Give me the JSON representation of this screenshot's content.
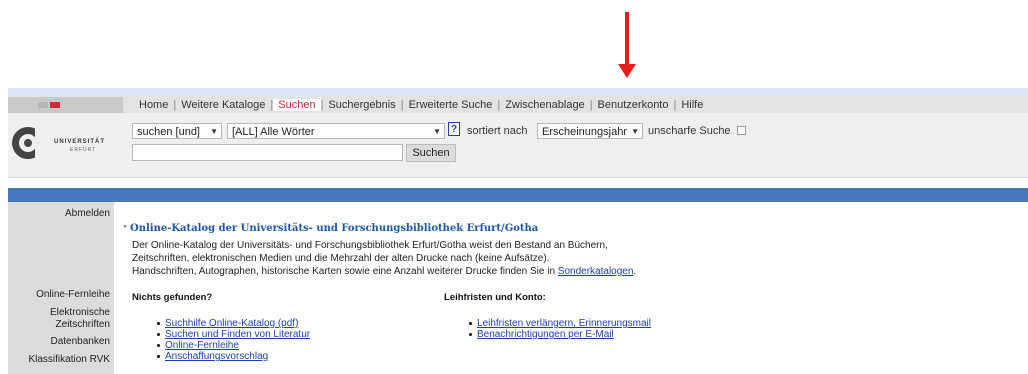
{
  "flags": {
    "de": "German flag",
    "uk": "UK flag"
  },
  "logo": {
    "line1": "UNIVERSITÄT",
    "line2": "ERFURT"
  },
  "menu": [
    "Home",
    "Weitere Kataloge",
    "Suchen",
    "Suchergebnis",
    "Erweiterte Suche",
    "Zwischenablage",
    "Benutzerkonto",
    "Hilfe"
  ],
  "search": {
    "mode": "suchen [und]",
    "field": "[ALL] Alle Wörter",
    "help_icon": "?",
    "sorted_label": "sortiert nach",
    "sort_value": "Erscheinungsjahr",
    "fuzzy_label": "unscharfe Suche",
    "query": "",
    "button": "Suchen"
  },
  "sidebar": {
    "logout": "Abmelden",
    "items": [
      "Online-Fernleihe",
      "Elektronische",
      "Zeitschriften",
      "Datenbanken",
      "Klassifikation RVK"
    ]
  },
  "main": {
    "title": "Online-Katalog der Universitäts- und Forschungsbibliothek Erfurt/Gotha",
    "intro_line1": "Der Online-Katalog der Universitäts- und Forschungsbibliothek Erfurt/Gotha weist den Bestand an Büchern,",
    "intro_line2": "Zeitschriften, elektronischen Medien und die Mehrzahl der alten Drucke nach (keine Aufsätze).",
    "intro_line3_prefix": "Handschriften, Autographen, historische Karten sowie eine Anzahl weiterer Drucke finden Sie in ",
    "intro_link": "Sonderkatalogen",
    "intro_line3_suffix": ".",
    "left_heading": "Nichts gefunden?",
    "left_links": [
      "Suchhilfe Online-Katalog (pdf)",
      "Suchen und Finden von Literatur",
      "Online-Fernleihe",
      "Anschaffungsvorschlag"
    ],
    "right_heading": "Leihfristen und Konto:",
    "right_links": [
      "Leihfristen verlängern, Erinnerungsmail",
      "Benachrichtigungen per E-Mail"
    ]
  },
  "colors": {
    "accent_red": "#e81c1c",
    "nav_active": "#d0283c",
    "blue_bar": "#4a78bd",
    "link": "#1a3fb0"
  }
}
